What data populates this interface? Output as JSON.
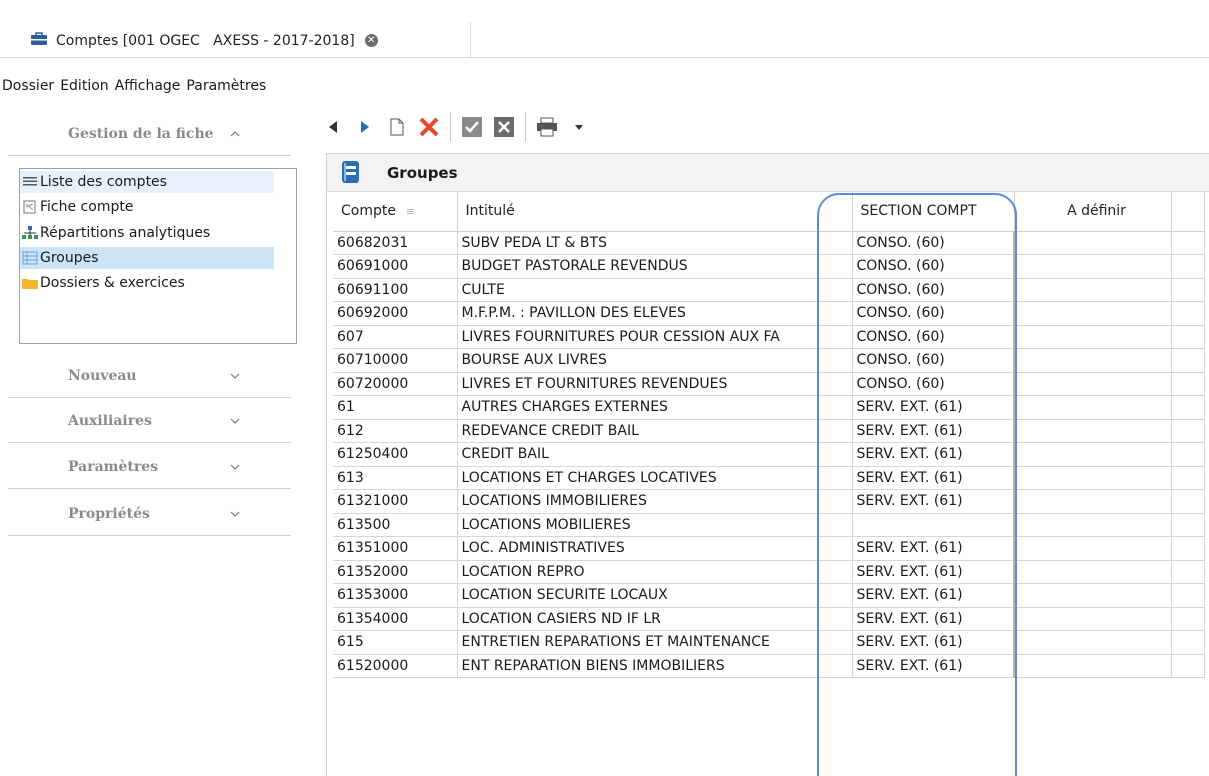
{
  "tab": {
    "title": "Comptes [001 OGEC   AXESS - 2017-2018]",
    "icon": "briefcase-icon",
    "close_icon": "close-icon"
  },
  "menu": [
    "Dossier",
    "Edition",
    "Affichage",
    "Paramètres"
  ],
  "leftpanel": {
    "sections": [
      {
        "label": "Gestion de la fiche",
        "expanded": true
      },
      {
        "label": "Nouveau",
        "expanded": false
      },
      {
        "label": "Auxiliaires",
        "expanded": false
      },
      {
        "label": "Paramètres",
        "expanded": false
      },
      {
        "label": "Propriétés",
        "expanded": false
      }
    ],
    "items": [
      {
        "label": "Liste des comptes",
        "icon": "list-icon"
      },
      {
        "label": "Fiche compte",
        "icon": "form-icon"
      },
      {
        "label": "Répartitions analytiques",
        "icon": "hierarchy-icon"
      },
      {
        "label": "Groupes",
        "icon": "grid-icon",
        "selected": true
      },
      {
        "label": "Dossiers & exercices",
        "icon": "folder-icon"
      }
    ]
  },
  "toolbar": {
    "buttons": [
      "prev-icon",
      "next-icon",
      "new-document-icon",
      "delete-icon",
      "validate-icon",
      "cancel-icon",
      "print-icon",
      "dropdown-icon"
    ]
  },
  "grid": {
    "title": "Groupes",
    "columns": [
      "Compte",
      "Intitulé",
      "SECTION COMPT",
      "A définir"
    ],
    "rows": [
      [
        "60682031",
        "SUBV PEDA   LT & BTS",
        "CONSO. (60)",
        ""
      ],
      [
        "60691000",
        "BUDGET PASTORALE REVENDUS",
        "CONSO. (60)",
        ""
      ],
      [
        "60691100",
        "CULTE",
        "CONSO. (60)",
        ""
      ],
      [
        "60692000",
        "M.F.P.M. : PAVILLON DES ELEVES",
        "CONSO. (60)",
        ""
      ],
      [
        "607",
        "LIVRES FOURNITURES POUR CESSION AUX FA",
        "CONSO. (60)",
        ""
      ],
      [
        "60710000",
        "BOURSE AUX LIVRES",
        "CONSO. (60)",
        ""
      ],
      [
        "60720000",
        "LIVRES ET FOURNITURES REVENDUES",
        "CONSO. (60)",
        ""
      ],
      [
        "61",
        "AUTRES CHARGES EXTERNES",
        "SERV. EXT. (61)",
        ""
      ],
      [
        "612",
        "REDEVANCE CREDIT BAIL",
        "SERV. EXT. (61)",
        ""
      ],
      [
        "61250400",
        "CREDIT BAIL",
        "SERV. EXT. (61)",
        ""
      ],
      [
        "613",
        "LOCATIONS ET CHARGES LOCATIVES",
        "SERV. EXT. (61)",
        ""
      ],
      [
        "61321000",
        "LOCATIONS IMMOBILIERES",
        "SERV. EXT. (61)",
        ""
      ],
      [
        "613500",
        "LOCATIONS MOBILIERES",
        "",
        ""
      ],
      [
        "61351000",
        "LOC. ADMINISTRATIVES",
        "SERV. EXT. (61)",
        ""
      ],
      [
        "61352000",
        "LOCATION REPRO",
        "SERV. EXT. (61)",
        ""
      ],
      [
        "61353000",
        "LOCATION SECURITE LOCAUX",
        "SERV. EXT. (61)",
        ""
      ],
      [
        "61354000",
        "LOCATION CASIERS ND IF LR",
        "SERV. EXT. (61)",
        ""
      ],
      [
        "615",
        "ENTRETIEN REPARATIONS ET MAINTENANCE",
        "SERV. EXT. (61)",
        ""
      ],
      [
        "61520000",
        "ENT REPARATION BIENS IMMOBILIERS",
        "SERV. EXT. (61)",
        ""
      ]
    ]
  },
  "colors": {
    "highlight": "#5b8bd6",
    "delete": "#e8462a",
    "selected": "#cce4f7"
  }
}
